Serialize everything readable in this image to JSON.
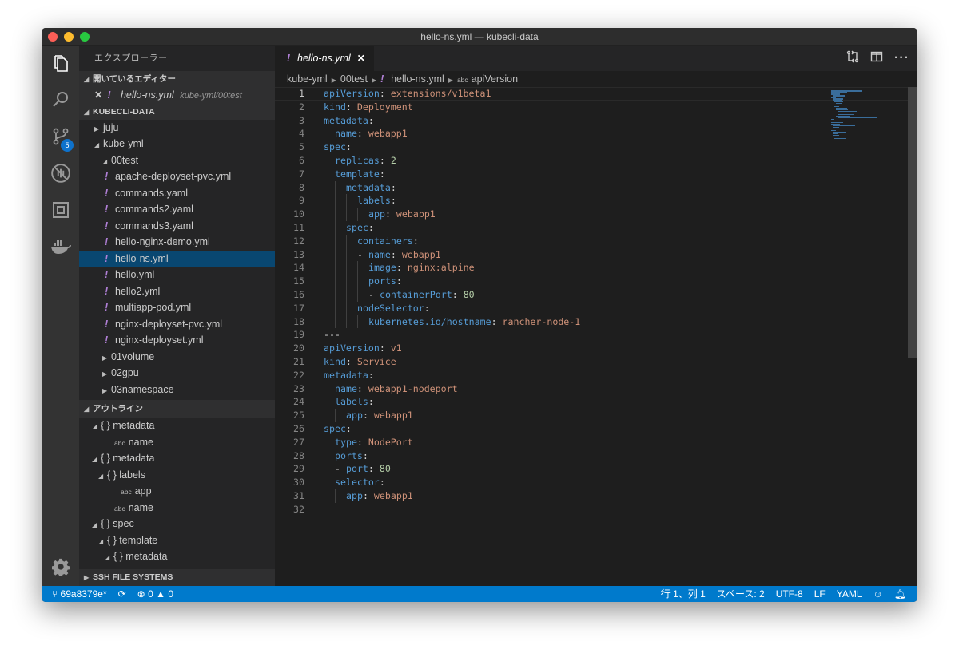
{
  "window": {
    "title": "hello-ns.yml — kubecli-data"
  },
  "activity": {
    "scm_badge": "5"
  },
  "sidebar": {
    "title": "エクスプローラー",
    "open_editors": {
      "label": "開いているエディター",
      "items": [
        {
          "name": "hello-ns.yml",
          "path": "kube-yml/00test"
        }
      ]
    },
    "folder": {
      "label": "KUBECLI-DATA",
      "items": [
        {
          "name": "juju",
          "type": "folder",
          "level": 0,
          "expanded": false
        },
        {
          "name": "kube-yml",
          "type": "folder",
          "level": 0,
          "expanded": true
        },
        {
          "name": "00test",
          "type": "folder",
          "level": 1,
          "expanded": true
        },
        {
          "name": "apache-deployset-pvc.yml",
          "type": "file",
          "level": 2
        },
        {
          "name": "commands.yaml",
          "type": "file",
          "level": 2
        },
        {
          "name": "commands2.yaml",
          "type": "file",
          "level": 2
        },
        {
          "name": "commands3.yaml",
          "type": "file",
          "level": 2
        },
        {
          "name": "hello-nginx-demo.yml",
          "type": "file",
          "level": 2
        },
        {
          "name": "hello-ns.yml",
          "type": "file",
          "level": 2,
          "selected": true
        },
        {
          "name": "hello.yml",
          "type": "file",
          "level": 2
        },
        {
          "name": "hello2.yml",
          "type": "file",
          "level": 2
        },
        {
          "name": "multiapp-pod.yml",
          "type": "file",
          "level": 2
        },
        {
          "name": "nginx-deployset-pvc.yml",
          "type": "file",
          "level": 2
        },
        {
          "name": "nginx-deployset.yml",
          "type": "file",
          "level": 2
        },
        {
          "name": "01volume",
          "type": "folder",
          "level": 1,
          "expanded": false
        },
        {
          "name": "02gpu",
          "type": "folder",
          "level": 1,
          "expanded": false
        },
        {
          "name": "03namespace",
          "type": "folder",
          "level": 1,
          "expanded": false
        }
      ]
    },
    "outline": {
      "label": "アウトライン",
      "items": [
        {
          "name": "metadata",
          "type": "object",
          "level": 0
        },
        {
          "name": "name",
          "type": "string",
          "level": 1
        },
        {
          "name": "metadata",
          "type": "object",
          "level": 0
        },
        {
          "name": "labels",
          "type": "object",
          "level": 1
        },
        {
          "name": "app",
          "type": "string",
          "level": 2
        },
        {
          "name": "name",
          "type": "string",
          "level": 1
        },
        {
          "name": "spec",
          "type": "object",
          "level": 0
        },
        {
          "name": "template",
          "type": "object",
          "level": 1
        },
        {
          "name": "metadata",
          "type": "object",
          "level": 2
        }
      ]
    },
    "ssh": {
      "label": "SSH FILE SYSTEMS"
    }
  },
  "editor": {
    "tab": "hello-ns.yml",
    "breadcrumb": [
      "kube-yml",
      "00test",
      "hello-ns.yml",
      "apiVersion"
    ],
    "current_line": 1,
    "lines": [
      {
        "i": 0,
        "k": "apiVersion",
        "v": "extensions/v1beta1",
        "t": "s"
      },
      {
        "i": 0,
        "k": "kind",
        "v": "Deployment",
        "t": "s"
      },
      {
        "i": 0,
        "k": "metadata"
      },
      {
        "i": 1,
        "k": "name",
        "v": "webapp1",
        "t": "s"
      },
      {
        "i": 0,
        "k": "spec"
      },
      {
        "i": 1,
        "k": "replicas",
        "v": "2",
        "t": "n"
      },
      {
        "i": 1,
        "k": "template"
      },
      {
        "i": 2,
        "k": "metadata"
      },
      {
        "i": 3,
        "k": "labels"
      },
      {
        "i": 4,
        "k": "app",
        "v": "webapp1",
        "t": "s"
      },
      {
        "i": 2,
        "k": "spec"
      },
      {
        "i": 3,
        "k": "containers"
      },
      {
        "i": 3,
        "d": true,
        "k": "name",
        "v": "webapp1",
        "t": "s"
      },
      {
        "i": 4,
        "k": "image",
        "v": "nginx:alpine",
        "t": "s"
      },
      {
        "i": 4,
        "k": "ports"
      },
      {
        "i": 4,
        "d": true,
        "k": "containerPort",
        "v": "80",
        "t": "n"
      },
      {
        "i": 3,
        "k": "nodeSelector"
      },
      {
        "i": 4,
        "k": "kubernetes.io/hostname",
        "v": "rancher-node-1",
        "t": "s"
      },
      {
        "i": 0,
        "raw": "---"
      },
      {
        "i": 0,
        "k": "apiVersion",
        "v": "v1",
        "t": "s"
      },
      {
        "i": 0,
        "k": "kind",
        "v": "Service",
        "t": "s"
      },
      {
        "i": 0,
        "k": "metadata"
      },
      {
        "i": 1,
        "k": "name",
        "v": "webapp1-nodeport",
        "t": "s"
      },
      {
        "i": 1,
        "k": "labels"
      },
      {
        "i": 2,
        "k": "app",
        "v": "webapp1",
        "t": "s"
      },
      {
        "i": 0,
        "k": "spec"
      },
      {
        "i": 1,
        "k": "type",
        "v": "NodePort",
        "t": "s"
      },
      {
        "i": 1,
        "k": "ports"
      },
      {
        "i": 1,
        "d": true,
        "k": "port",
        "v": "80",
        "t": "n"
      },
      {
        "i": 1,
        "k": "selector"
      },
      {
        "i": 2,
        "k": "app",
        "v": "webapp1",
        "t": "s"
      },
      {
        "i": 0,
        "raw": ""
      }
    ]
  },
  "status": {
    "branch": "69a8379e*",
    "errors": "0",
    "warnings": "0",
    "position": "行 1、列 1",
    "spaces": "スペース: 2",
    "encoding": "UTF-8",
    "eol": "LF",
    "language": "YAML"
  }
}
